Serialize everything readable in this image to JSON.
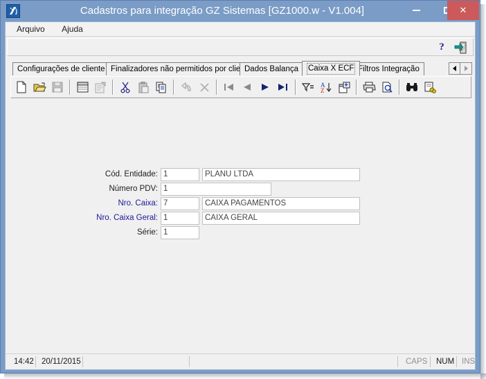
{
  "window": {
    "title": "Cadastros para integração GZ Sistemas [GZ1000.w - V1.004]",
    "app_icon": "app-logo-icon",
    "minimize_label": "−",
    "maximize_label": "□",
    "close_label": "✕",
    "accent_titlebar": "#7a9cc6",
    "accent_close": "#cc5a5a"
  },
  "menubar": {
    "items": [
      {
        "label": "Arquivo"
      },
      {
        "label": "Ajuda"
      }
    ]
  },
  "helpbar": {
    "help_label": "?",
    "exit_icon": "exit-door-icon"
  },
  "tabs": {
    "items": [
      {
        "label": "Configurações de cliente",
        "selected": false
      },
      {
        "label": "Finalizadores não permitidos por cliente",
        "selected": false
      },
      {
        "label": "Dados Balança",
        "selected": false
      },
      {
        "label": "Caixa X ECF",
        "selected": true
      },
      {
        "label": "Filtros Integração",
        "selected": false
      }
    ],
    "scroll_left_icon": "scroll-left-icon",
    "scroll_right_icon": "scroll-right-icon"
  },
  "toolbar": {
    "buttons": [
      {
        "name": "new-icon",
        "title": "Novo",
        "enabled": true
      },
      {
        "name": "open-folder-icon",
        "title": "Abrir",
        "enabled": true
      },
      {
        "name": "save-disk-icon",
        "title": "Salvar",
        "enabled": false
      },
      {
        "sep": true
      },
      {
        "name": "form-view-icon",
        "title": "Formulário",
        "enabled": true
      },
      {
        "name": "properties-icon",
        "title": "Propriedades",
        "enabled": false
      },
      {
        "sep": true
      },
      {
        "name": "cut-scissors-icon",
        "title": "Recortar",
        "enabled": true
      },
      {
        "name": "paste-clipboard-icon",
        "title": "Colar",
        "enabled": false
      },
      {
        "name": "copy-pages-icon",
        "title": "Copiar",
        "enabled": true
      },
      {
        "sep": true
      },
      {
        "name": "undo-arrow-icon",
        "title": "Desfazer",
        "enabled": false
      },
      {
        "name": "delete-x-icon",
        "title": "Excluir",
        "enabled": false
      },
      {
        "sep": true
      },
      {
        "name": "nav-first-icon",
        "title": "Primeiro",
        "enabled": false
      },
      {
        "name": "nav-prev-icon",
        "title": "Anterior",
        "enabled": false
      },
      {
        "name": "nav-next-icon",
        "title": "Próximo",
        "enabled": true
      },
      {
        "name": "nav-last-icon",
        "title": "Último",
        "enabled": true
      },
      {
        "sep": true
      },
      {
        "name": "filter-icon",
        "title": "Filtrar",
        "enabled": true
      },
      {
        "name": "sort-az-icon",
        "title": "Ordenar",
        "enabled": true
      },
      {
        "name": "new-window-icon",
        "title": "Nova janela",
        "enabled": true
      },
      {
        "sep": true
      },
      {
        "name": "print-icon",
        "title": "Imprimir",
        "enabled": true
      },
      {
        "name": "print-preview-icon",
        "title": "Visualizar impressão",
        "enabled": true
      },
      {
        "sep": true
      },
      {
        "name": "find-binoculars-icon",
        "title": "Procurar",
        "enabled": true
      },
      {
        "name": "advanced-search-icon",
        "title": "Busca avançada",
        "enabled": true
      }
    ]
  },
  "form": {
    "fields": [
      {
        "label": "Cód. Entidade:",
        "label_color": "dark",
        "code": "1",
        "description": "PLANU LTDA",
        "has_description": true
      },
      {
        "label": "Número PDV:",
        "label_color": "dark",
        "code": "1",
        "description": "",
        "has_description": false,
        "wide": true
      },
      {
        "label": "Nro. Caixa:",
        "label_color": "blue",
        "code": "7",
        "description": "CAIXA PAGAMENTOS",
        "has_description": true
      },
      {
        "label": "Nro. Caixa Geral:",
        "label_color": "blue",
        "code": "1",
        "description": "CAIXA GERAL",
        "has_description": true
      },
      {
        "label": "Série:",
        "label_color": "dark",
        "code": "1",
        "description": "",
        "has_description": false
      }
    ]
  },
  "statusbar": {
    "time": "14:42",
    "date": "20/11/2015",
    "message": "",
    "caps": "CAPS",
    "num": "NUM",
    "ins": "INS"
  }
}
